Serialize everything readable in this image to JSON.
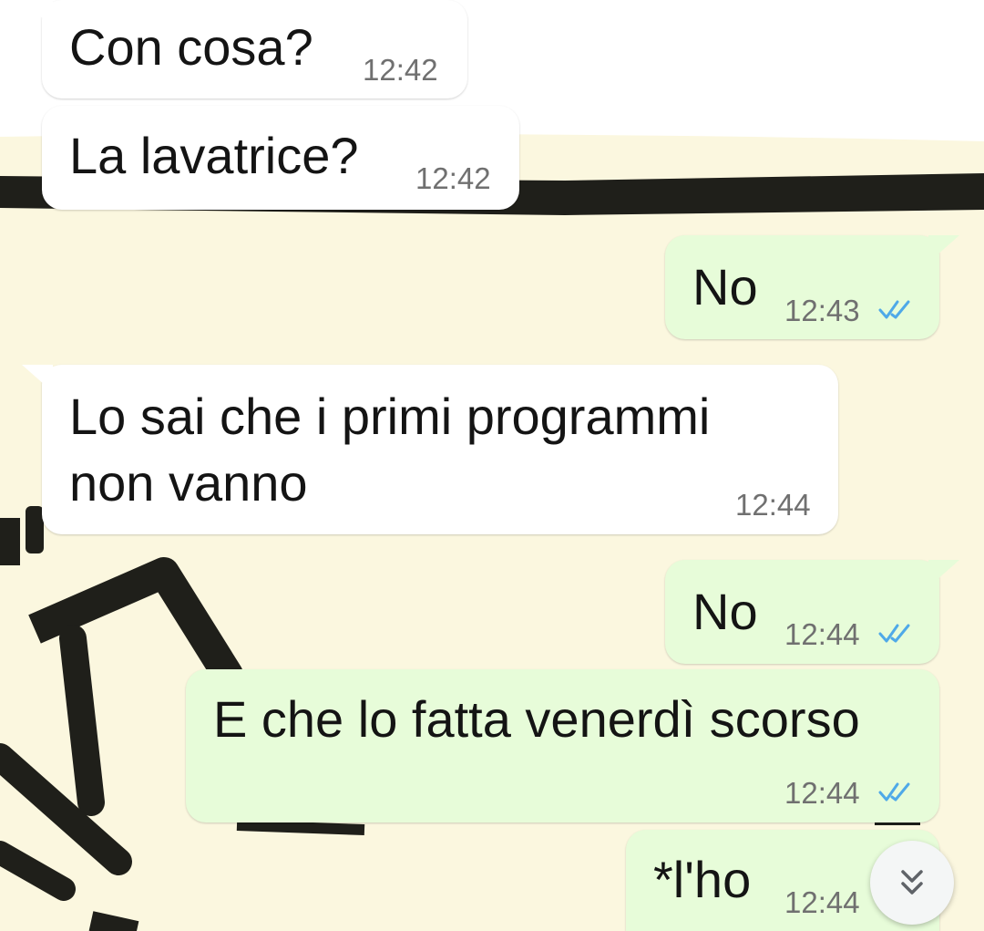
{
  "messages": [
    {
      "direction": "incoming",
      "text": "Con cosa?",
      "time": "12:42"
    },
    {
      "direction": "incoming",
      "text": "La lavatrice?",
      "time": "12:42"
    },
    {
      "direction": "outgoing",
      "text": "No",
      "time": "12:43",
      "status": "read"
    },
    {
      "direction": "incoming",
      "text_line1": "Lo sai che i primi programmi",
      "text_line2": "non vanno",
      "time": "12:44"
    },
    {
      "direction": "outgoing",
      "text": "No",
      "time": "12:44",
      "status": "read"
    },
    {
      "direction": "outgoing",
      "text": "E che lo fatta venerdì scorso",
      "time": "12:44",
      "status": "read"
    },
    {
      "direction": "outgoing",
      "text": "*l'ho",
      "time": "12:44",
      "status": "read"
    }
  ],
  "icons": {
    "read_receipt": "double-check-icon",
    "scroll": "double-chevron-down-icon"
  },
  "colors": {
    "incoming_bubble": "#ffffff",
    "outgoing_bubble": "#e7fcd9",
    "read_tick": "#4fa9e8",
    "wallpaper": "#fbf7df",
    "timestamp": "#707070"
  }
}
